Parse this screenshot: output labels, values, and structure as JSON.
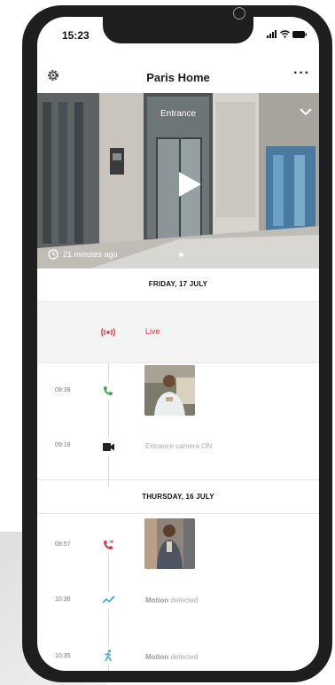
{
  "status_bar": {
    "time": "15:23"
  },
  "app": {
    "title": "Paris Home"
  },
  "camera": {
    "name": "Entrance",
    "last_seen": "21 minutes ago"
  },
  "sections": [
    {
      "date": "FRIDAY, 17 JULY"
    },
    {
      "date": "THURSDAY, 16 JULY"
    }
  ],
  "events": [
    {
      "label": "Live"
    },
    {
      "time": "09:39"
    },
    {
      "time": "09:16",
      "label": "Entrance camera ON"
    },
    {
      "time": "08:57"
    },
    {
      "time": "10:36",
      "label_bold": "Motion",
      "label": "detected"
    },
    {
      "time": "10:35",
      "label_bold": "Motion",
      "label": "detected"
    }
  ],
  "colors": {
    "live_red": "#e5323e",
    "call_green": "#3fa34d",
    "motion_blue": "#3fa6d8",
    "frame": "#1e1e1e"
  },
  "icons": [
    "gear-icon",
    "more-icon",
    "chevron-down-icon",
    "play-icon",
    "clock-icon",
    "live-broadcast-icon",
    "phone-answered-icon",
    "video-camera-icon",
    "phone-missed-icon",
    "motion-graph-icon",
    "person-walking-icon"
  ]
}
